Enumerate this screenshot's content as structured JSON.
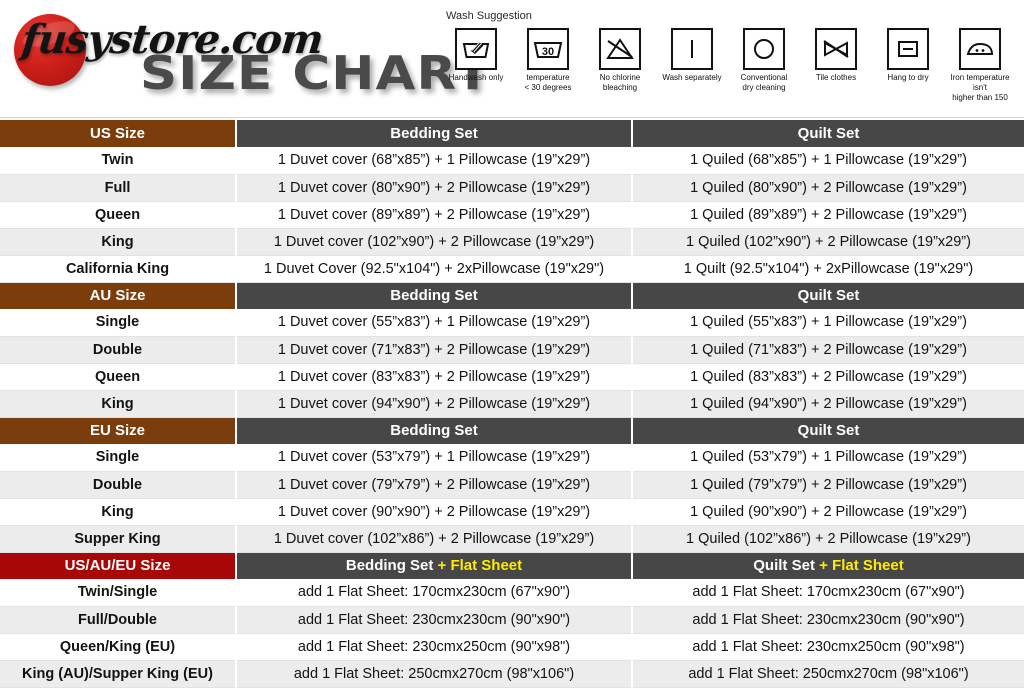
{
  "brand": {
    "script_text": "fusystore.com",
    "title": "SIZE CHART",
    "disc_color": "#cf1f1a",
    "title_color": "#4a4a4a"
  },
  "wash": {
    "title": "Wash Suggestion",
    "items": [
      {
        "icon": "handwash-only-icon",
        "label": "Handwash only"
      },
      {
        "icon": "wash-temp-30-icon",
        "label": "temperature\n< 30 degrees",
        "value": "30"
      },
      {
        "icon": "no-chlorine-bleach-icon",
        "label": "No chlorine\nbleaching"
      },
      {
        "icon": "wash-separately-icon",
        "label": "Wash separately"
      },
      {
        "icon": "conventional-dry-cleaning-icon",
        "label": "Conventional\ndry cleaning"
      },
      {
        "icon": "no-tumble-dry-icon",
        "label": "Tile clothes"
      },
      {
        "icon": "hang-to-dry-icon",
        "label": "Hang to dry"
      },
      {
        "icon": "iron-low-temp-icon",
        "label": "Iron temperature isn't\nhigher than 150"
      }
    ]
  },
  "colors": {
    "brown_header": "#7b3d0c",
    "red_header": "#a80707",
    "dark_header": "#474747",
    "highlight_text": "#ffec00",
    "row_even": "#ececec",
    "row_odd": "#ffffff"
  },
  "sections": [
    {
      "id": "us",
      "header": {
        "size_label": "US Size",
        "col2_label": "Bedding Set",
        "col3_label": "Quilt Set",
        "label_style": "brown"
      },
      "rows": [
        {
          "size": "Twin",
          "bedding": "1 Duvet cover (68”x85”) + 1 Pillowcase (19”x29”)",
          "quilt": "1 Quiled (68”x85”) + 1 Pillowcase (19”x29”)"
        },
        {
          "size": "Full",
          "bedding": "1 Duvet cover (80”x90”) + 2 Pillowcase (19”x29”)",
          "quilt": "1 Quiled (80”x90”) + 2 Pillowcase (19”x29”)"
        },
        {
          "size": "Queen",
          "bedding": "1 Duvet cover (89”x89”) + 2 Pillowcase (19”x29”)",
          "quilt": "1 Quiled (89”x89”) + 2 Pillowcase (19”x29”)"
        },
        {
          "size": "King",
          "bedding": "1 Duvet cover (102”x90”) + 2 Pillowcase (19”x29”)",
          "quilt": "1 Quiled (102”x90”) + 2 Pillowcase (19”x29”)"
        },
        {
          "size": "California King",
          "bedding": "1 Duvet Cover (92.5\"x104\") + 2xPillowcase (19\"x29\")",
          "quilt": "1 Quilt (92.5\"x104\") + 2xPillowcase (19\"x29\")"
        }
      ]
    },
    {
      "id": "au",
      "header": {
        "size_label": "AU Size",
        "col2_label": "Bedding Set",
        "col3_label": "Quilt Set",
        "label_style": "brown"
      },
      "rows": [
        {
          "size": "Single",
          "bedding": "1 Duvet cover (55”x83”) + 1 Pillowcase (19”x29”)",
          "quilt": "1 Quiled (55”x83”) + 1 Pillowcase (19”x29”)"
        },
        {
          "size": "Double",
          "bedding": "1 Duvet cover (71”x83”) + 2 Pillowcase (19”x29”)",
          "quilt": "1 Quiled (71”x83”) + 2 Pillowcase (19”x29”)"
        },
        {
          "size": "Queen",
          "bedding": "1 Duvet cover (83”x83”) + 2 Pillowcase (19”x29”)",
          "quilt": "1 Quiled (83”x83”) + 2 Pillowcase (19”x29”)"
        },
        {
          "size": "King",
          "bedding": "1 Duvet cover (94”x90”) + 2 Pillowcase (19”x29”)",
          "quilt": "1 Quiled (94”x90”) + 2 Pillowcase (19”x29”)"
        }
      ]
    },
    {
      "id": "eu",
      "header": {
        "size_label": "EU Size",
        "col2_label": "Bedding Set",
        "col3_label": "Quilt Set",
        "label_style": "brown"
      },
      "rows": [
        {
          "size": "Single",
          "bedding": "1 Duvet cover (53”x79”) + 1 Pillowcase (19”x29”)",
          "quilt": "1 Quiled (53”x79”) + 1 Pillowcase (19”x29”)"
        },
        {
          "size": "Double",
          "bedding": "1 Duvet cover (79”x79”) + 2 Pillowcase (19”x29”)",
          "quilt": "1 Quiled (79”x79”) + 2 Pillowcase (19”x29”)"
        },
        {
          "size": "King",
          "bedding": "1 Duvet cover (90”x90”) + 2 Pillowcase (19”x29”)",
          "quilt": "1 Quiled (90”x90”) + 2 Pillowcase (19”x29”)"
        },
        {
          "size": "Supper King",
          "bedding": "1 Duvet cover (102”x86”) + 2 Pillowcase (19”x29”)",
          "quilt": "1 Quiled (102”x86”) + 2 Pillowcase (19”x29”)"
        }
      ]
    },
    {
      "id": "flatsheet",
      "header": {
        "size_label": "US/AU/EU Size",
        "col2_label": "Bedding Set ",
        "col2_label_hl": "+ Flat Sheet",
        "col3_label": "Quilt Set ",
        "col3_label_hl": "+ Flat Sheet",
        "label_style": "red"
      },
      "rows": [
        {
          "size": "Twin/Single",
          "bedding": "add 1 Flat Sheet: 170cmx230cm (67\"x90\")",
          "quilt": "add 1 Flat Sheet: 170cmx230cm (67\"x90\")"
        },
        {
          "size": "Full/Double",
          "bedding": "add 1 Flat Sheet: 230cmx230cm (90\"x90\")",
          "quilt": "add 1 Flat Sheet: 230cmx230cm (90\"x90\")"
        },
        {
          "size": "Queen/King (EU)",
          "bedding": "add 1 Flat Sheet: 230cmx250cm (90\"x98\")",
          "quilt": "add 1 Flat Sheet: 230cmx250cm (90\"x98\")"
        },
        {
          "size": "King (AU)/Supper King (EU)",
          "bedding": "add 1 Flat Sheet: 250cmx270cm (98\"x106\")",
          "quilt": "add 1 Flat Sheet: 250cmx270cm (98\"x106\")"
        }
      ]
    }
  ]
}
